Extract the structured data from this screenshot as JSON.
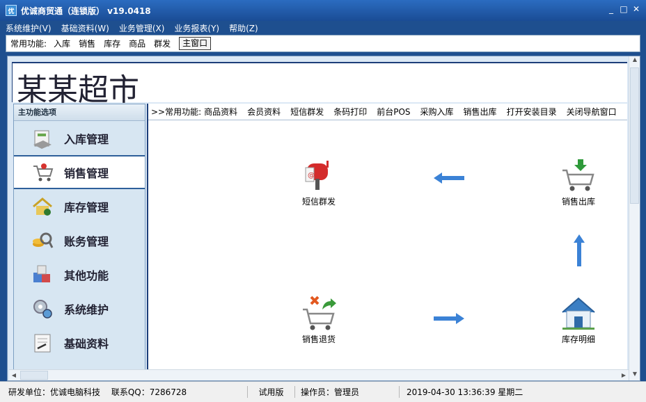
{
  "window": {
    "title": "优诚商贸通（连锁版） v19.0418",
    "app_icon_text": "优",
    "min": "_",
    "max": "□",
    "close": "✕"
  },
  "menu": [
    "系统维护(V)",
    "基础资料(W)",
    "业务管理(X)",
    "业务报表(Y)",
    "帮助(Z)"
  ],
  "toolbar": {
    "label": "常用功能:",
    "items": [
      "入库",
      "销售",
      "库存",
      "商品",
      "群发"
    ],
    "main_window": "主窗口"
  },
  "banner": {
    "title": "某某超市"
  },
  "sidebar": {
    "header": "主功能选项",
    "items": [
      {
        "label": "入库管理",
        "icon": "inbound-icon"
      },
      {
        "label": "销售管理",
        "icon": "sales-cart-icon"
      },
      {
        "label": "库存管理",
        "icon": "inventory-house-icon"
      },
      {
        "label": "账务管理",
        "icon": "finance-coins-icon"
      },
      {
        "label": "其他功能",
        "icon": "other-abc-icon"
      },
      {
        "label": "系统维护",
        "icon": "system-gear-icon"
      },
      {
        "label": "基础资料",
        "icon": "basic-data-icon"
      }
    ]
  },
  "nav": {
    "prefix": ">>常用功能:",
    "items": [
      "商品资料",
      "会员资料",
      "短信群发",
      "条码打印",
      "前台POS",
      "采购入库",
      "销售出库",
      "打开安装目录",
      "关闭导航窗口"
    ]
  },
  "flow": {
    "sms": "短信群发",
    "outbound": "销售出库",
    "return": "销售退货",
    "stock": "库存明细"
  },
  "status": {
    "developer": "研发单位：优诚电脑科技",
    "qq": "联系QQ：7286728",
    "edition": "试用版",
    "operator": "操作员：管理员",
    "datetime": "2019-04-30 13:36:39 星期二"
  },
  "colors": {
    "title_bar": "#1e4f8f",
    "arrow": "#3b82d6"
  }
}
